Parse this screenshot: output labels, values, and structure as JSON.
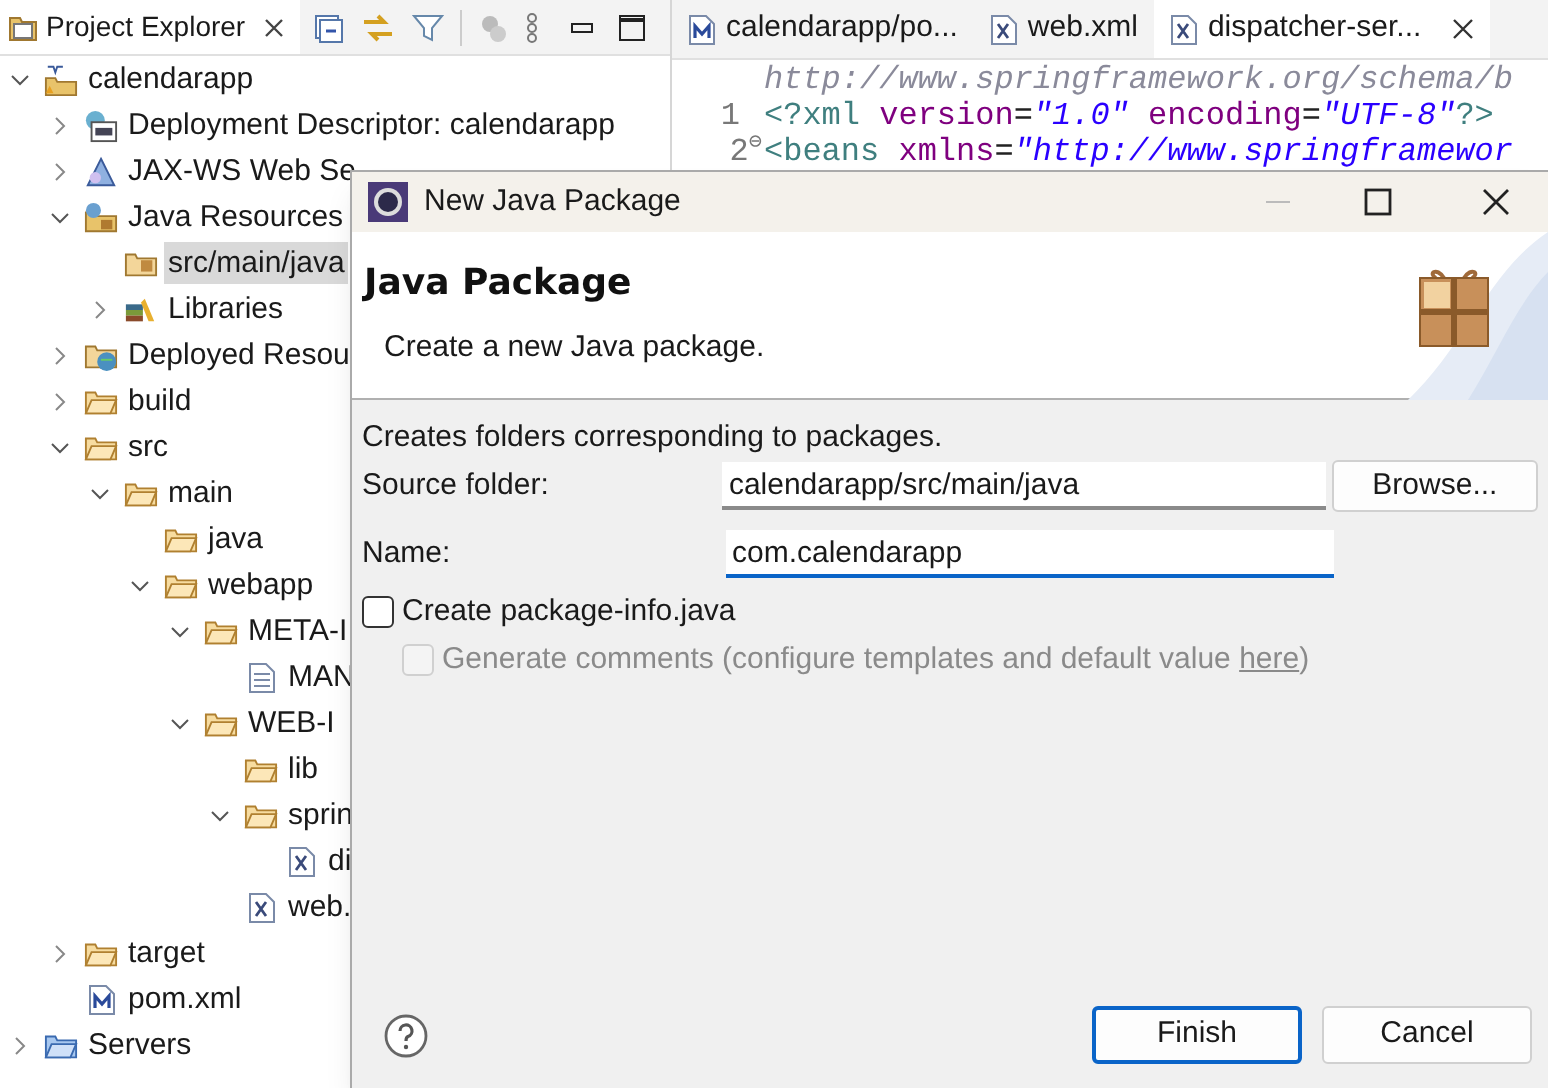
{
  "explorer": {
    "title": "Project Explorer",
    "tree": [
      {
        "label": "calendarapp",
        "kind": "project",
        "expanded": true,
        "selected": false,
        "children": [
          {
            "label": "Deployment Descriptor: calendarapp",
            "kind": "descriptor",
            "expanded": false,
            "selected": false
          },
          {
            "label": "JAX-WS Web Se",
            "kind": "webservices",
            "expanded": false,
            "selected": false
          },
          {
            "label": "Java Resources",
            "kind": "java-resources",
            "expanded": true,
            "selected": false,
            "children": [
              {
                "label": "src/main/java",
                "kind": "source-folder",
                "selected": true
              },
              {
                "label": "Libraries",
                "kind": "libraries",
                "expanded": false,
                "selected": false
              }
            ]
          },
          {
            "label": "Deployed Resou",
            "kind": "deployed",
            "expanded": false,
            "selected": false
          },
          {
            "label": "build",
            "kind": "folder",
            "expanded": false,
            "selected": false
          },
          {
            "label": "src",
            "kind": "folder",
            "expanded": true,
            "selected": false,
            "children": [
              {
                "label": "main",
                "kind": "folder",
                "expanded": true,
                "selected": false,
                "children": [
                  {
                    "label": "java",
                    "kind": "folder",
                    "selected": false
                  },
                  {
                    "label": "webapp",
                    "kind": "folder",
                    "expanded": true,
                    "selected": false,
                    "children": [
                      {
                        "label": "META-I",
                        "kind": "folder",
                        "expanded": true,
                        "selected": false,
                        "children": [
                          {
                            "label": "MAN",
                            "kind": "text-file",
                            "selected": false
                          }
                        ]
                      },
                      {
                        "label": "WEB-I",
                        "kind": "folder",
                        "expanded": true,
                        "selected": false,
                        "children": [
                          {
                            "label": "lib",
                            "kind": "folder",
                            "selected": false
                          },
                          {
                            "label": "sprin",
                            "kind": "folder",
                            "expanded": true,
                            "selected": false,
                            "children": [
                              {
                                "label": "di",
                                "kind": "xml-file",
                                "selected": false
                              }
                            ]
                          },
                          {
                            "label": "web.",
                            "kind": "xml-file",
                            "selected": false
                          }
                        ]
                      }
                    ]
                  }
                ]
              }
            ]
          },
          {
            "label": "target",
            "kind": "folder",
            "expanded": false,
            "selected": false
          },
          {
            "label": "pom.xml",
            "kind": "maven-file",
            "selected": false
          }
        ]
      },
      {
        "label": "Servers",
        "kind": "servers",
        "expanded": false,
        "selected": false
      }
    ]
  },
  "editor": {
    "tabs": [
      {
        "label": "calendarapp/po...",
        "kind": "maven-file",
        "selected": false
      },
      {
        "label": "web.xml",
        "kind": "xml-file",
        "selected": false
      },
      {
        "label": "dispatcher-ser...",
        "kind": "xml-file",
        "selected": true
      }
    ],
    "lines": [
      {
        "segments": [
          {
            "text": "http://www.springframework.org/schema/b",
            "kind": "hover"
          }
        ]
      },
      {
        "number": "1",
        "segments": [
          {
            "text": "<?xml",
            "kind": "tag"
          },
          {
            "text": " version",
            "kind": "attr"
          },
          {
            "text": "=",
            "kind": "plain"
          },
          {
            "text": "\"1.0\"",
            "kind": "string"
          },
          {
            "text": " encoding",
            "kind": "attr"
          },
          {
            "text": "=",
            "kind": "plain"
          },
          {
            "text": "\"UTF-8\"",
            "kind": "string"
          },
          {
            "text": "?>",
            "kind": "tag"
          }
        ]
      },
      {
        "number": "2",
        "fold": "⊖",
        "segments": [
          {
            "text": "<beans",
            "kind": "tag"
          },
          {
            "text": " xmlns",
            "kind": "attr"
          },
          {
            "text": "=",
            "kind": "plain"
          },
          {
            "text": "\"http://www.springframewor",
            "kind": "string"
          }
        ]
      }
    ]
  },
  "dialog": {
    "title": "New Java Package",
    "heading": "Java Package",
    "description": "Create a new Java package.",
    "message": "Creates folders corresponding to packages.",
    "fields": [
      {
        "label": "Source folder:",
        "value": "calendarapp/src/main/java",
        "focused": false,
        "button": "Browse..."
      },
      {
        "label": "Name:",
        "value": "com.calendarapp",
        "focused": true
      }
    ],
    "options": [
      {
        "label": "Create package-info.java",
        "checked": false,
        "disabled": false
      },
      {
        "label": "Generate comments (configure templates and default value ",
        "link": "here",
        "suffix": ")",
        "checked": false,
        "disabled": true
      }
    ],
    "buttons": [
      {
        "label": "Finish",
        "default": true
      },
      {
        "label": "Cancel",
        "default": false
      }
    ]
  }
}
